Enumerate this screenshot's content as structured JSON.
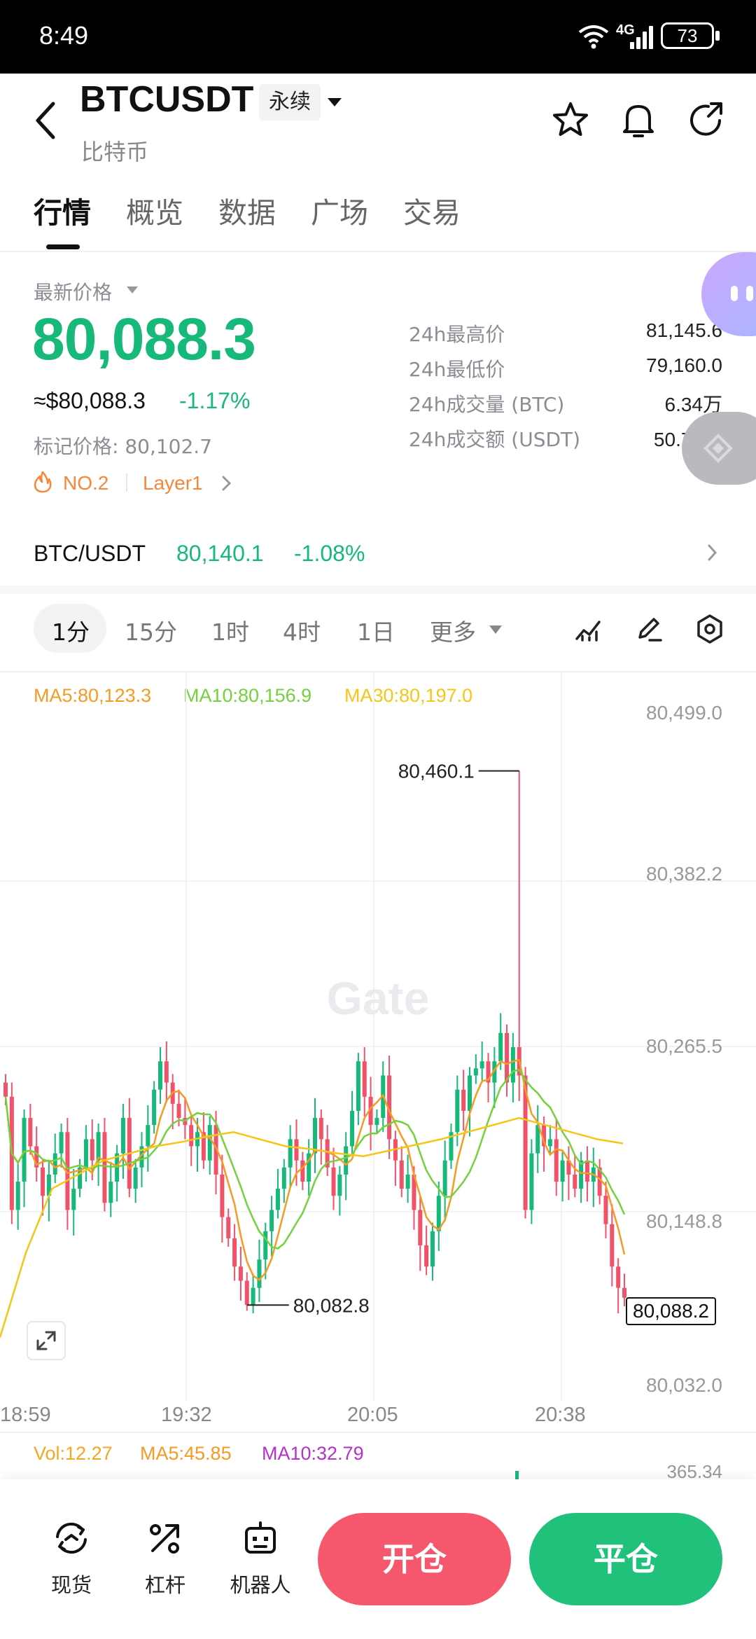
{
  "status_bar": {
    "time": "8:49",
    "network": "4G",
    "battery": "73"
  },
  "header": {
    "symbol": "BTCUSDT",
    "contract_tag": "永续",
    "name": "比特币"
  },
  "tabs": [
    {
      "label": "行情",
      "active": true
    },
    {
      "label": "概览",
      "active": false
    },
    {
      "label": "数据",
      "active": false
    },
    {
      "label": "广场",
      "active": false
    },
    {
      "label": "交易",
      "active": false
    }
  ],
  "price": {
    "label": "最新价格",
    "last": "80,088.3",
    "usd": "≈$80,088.3",
    "change": "-1.17%",
    "mark_label": "标记价格: 80,102.7",
    "rank": "NO.2",
    "category": "Layer1"
  },
  "stats": [
    {
      "label": "24h最高价",
      "value": "81,145.6"
    },
    {
      "label": "24h最低价",
      "value": "79,160.0"
    },
    {
      "label": "24h成交量 (BTC)",
      "value": "6.34万"
    },
    {
      "label": "24h成交额 (USDT)",
      "value": "50.78亿"
    }
  ],
  "spot": {
    "pair": "BTC/USDT",
    "price": "80,140.1",
    "change": "-1.08%"
  },
  "intervals": [
    "1分",
    "15分",
    "1时",
    "4时",
    "1日",
    "更多"
  ],
  "active_interval": "1分",
  "indicators": {
    "ma5": "MA5:80,123.3",
    "ma10": "MA10:80,156.9",
    "ma30": "MA30:80,197.0"
  },
  "volume": {
    "vol": "Vol:12.27",
    "ma5": "MA5:45.85",
    "ma10": "MA10:32.79",
    "axis_top": "365.34"
  },
  "watermark": "Gate",
  "colors": {
    "up": "#16b979",
    "down": "#f0526a",
    "ma5": "#f59a23",
    "ma10": "#73d13d",
    "ma30": "#f5c518",
    "open_btn": "#f5576c",
    "close_btn": "#1fc17b"
  },
  "chart_data": {
    "type": "candlestick",
    "price_axis": [
      "80,499.0",
      "80,382.2",
      "80,265.5",
      "80,148.8",
      "80,032.0"
    ],
    "time_axis": [
      "18:59",
      "19:32",
      "20:05",
      "20:38"
    ],
    "ylim": [
      80032.0,
      80499.0
    ],
    "high_marker": "80,460.1",
    "low_marker": "80,082.8",
    "current_price_tag": "80,088.2",
    "candles_close": [
      80230,
      80150,
      80170,
      80215,
      80195,
      80180,
      80160,
      80175,
      80190,
      80205,
      80150,
      80165,
      80180,
      80200,
      80185,
      80205,
      80155,
      80170,
      80190,
      80215,
      80165,
      80180,
      80195,
      80210,
      80235,
      80255,
      80240,
      80225,
      80215,
      80210,
      80195,
      80205,
      80185,
      80210,
      80175,
      80145,
      80130,
      80110,
      80100,
      80083,
      80095,
      80115,
      80135,
      80150,
      80165,
      80180,
      80200,
      80185,
      80170,
      80190,
      80215,
      80200,
      80180,
      80160,
      80175,
      80195,
      80220,
      80255,
      80230,
      80210,
      80215,
      80245,
      80200,
      80185,
      80165,
      80175,
      80150,
      80125,
      80110,
      80135,
      80160,
      80185,
      80205,
      80235,
      80220,
      80245,
      80250,
      80255,
      80240,
      80255,
      80275,
      80240,
      80265,
      80245,
      80150,
      80190,
      80210,
      80195,
      80200,
      80170,
      80185,
      80175,
      80165,
      80185,
      80170,
      80180,
      80160,
      80140,
      80110,
      80095,
      80088
    ],
    "ma30_samples": [
      80060,
      80120,
      80165,
      80175,
      80185,
      80190,
      80195,
      80198,
      80202,
      80205,
      80200,
      80195,
      80193,
      80190,
      80188,
      80192,
      80196,
      80200,
      80205,
      80210,
      80215,
      80210,
      80205,
      80200,
      80197
    ]
  },
  "bottom_nav": [
    {
      "label": "现货",
      "icon": "spot-icon"
    },
    {
      "label": "杠杆",
      "icon": "leverage-icon"
    },
    {
      "label": "机器人",
      "icon": "robot-icon"
    }
  ],
  "actions": {
    "open": "开仓",
    "close": "平仓"
  }
}
